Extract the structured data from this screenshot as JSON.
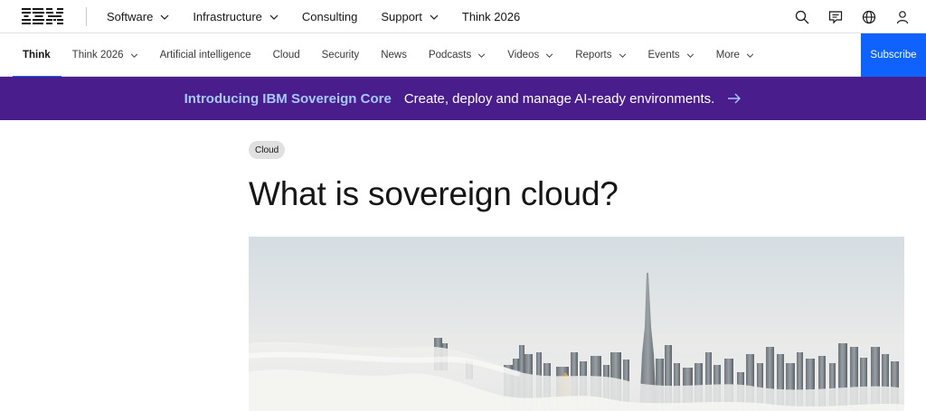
{
  "masthead": {
    "logo_text": "IBM",
    "nav": [
      {
        "label": "Software",
        "has_menu": true
      },
      {
        "label": "Infrastructure",
        "has_menu": true
      },
      {
        "label": "Consulting",
        "has_menu": false
      },
      {
        "label": "Support",
        "has_menu": true
      },
      {
        "label": "Think 2026",
        "has_menu": false
      }
    ],
    "icons": [
      "search-icon",
      "chat-icon",
      "globe-icon",
      "user-icon"
    ]
  },
  "subnav": {
    "items": [
      {
        "label": "Think",
        "active": true,
        "has_menu": false
      },
      {
        "label": "Think 2026",
        "has_menu": true
      },
      {
        "label": "Artificial intelligence",
        "has_menu": false
      },
      {
        "label": "Cloud",
        "has_menu": false
      },
      {
        "label": "Security",
        "has_menu": false
      },
      {
        "label": "News",
        "has_menu": false
      },
      {
        "label": "Podcasts",
        "has_menu": true
      },
      {
        "label": "Videos",
        "has_menu": true
      },
      {
        "label": "Reports",
        "has_menu": true
      },
      {
        "label": "Events",
        "has_menu": true
      },
      {
        "label": "More",
        "has_menu": true
      }
    ],
    "subscribe_label": "Subscribe"
  },
  "banner": {
    "title": "Introducing IBM Sovereign Core",
    "description": "Create, deploy and manage AI-ready environments.",
    "icon": "arrow-right-icon"
  },
  "article": {
    "tag": "Cloud",
    "title": "What is sovereign cloud?"
  },
  "colors": {
    "brand_blue": "#0f62fe",
    "banner_purple": "#491d8b",
    "banner_link": "#a6c8ff",
    "text": "#161616"
  }
}
